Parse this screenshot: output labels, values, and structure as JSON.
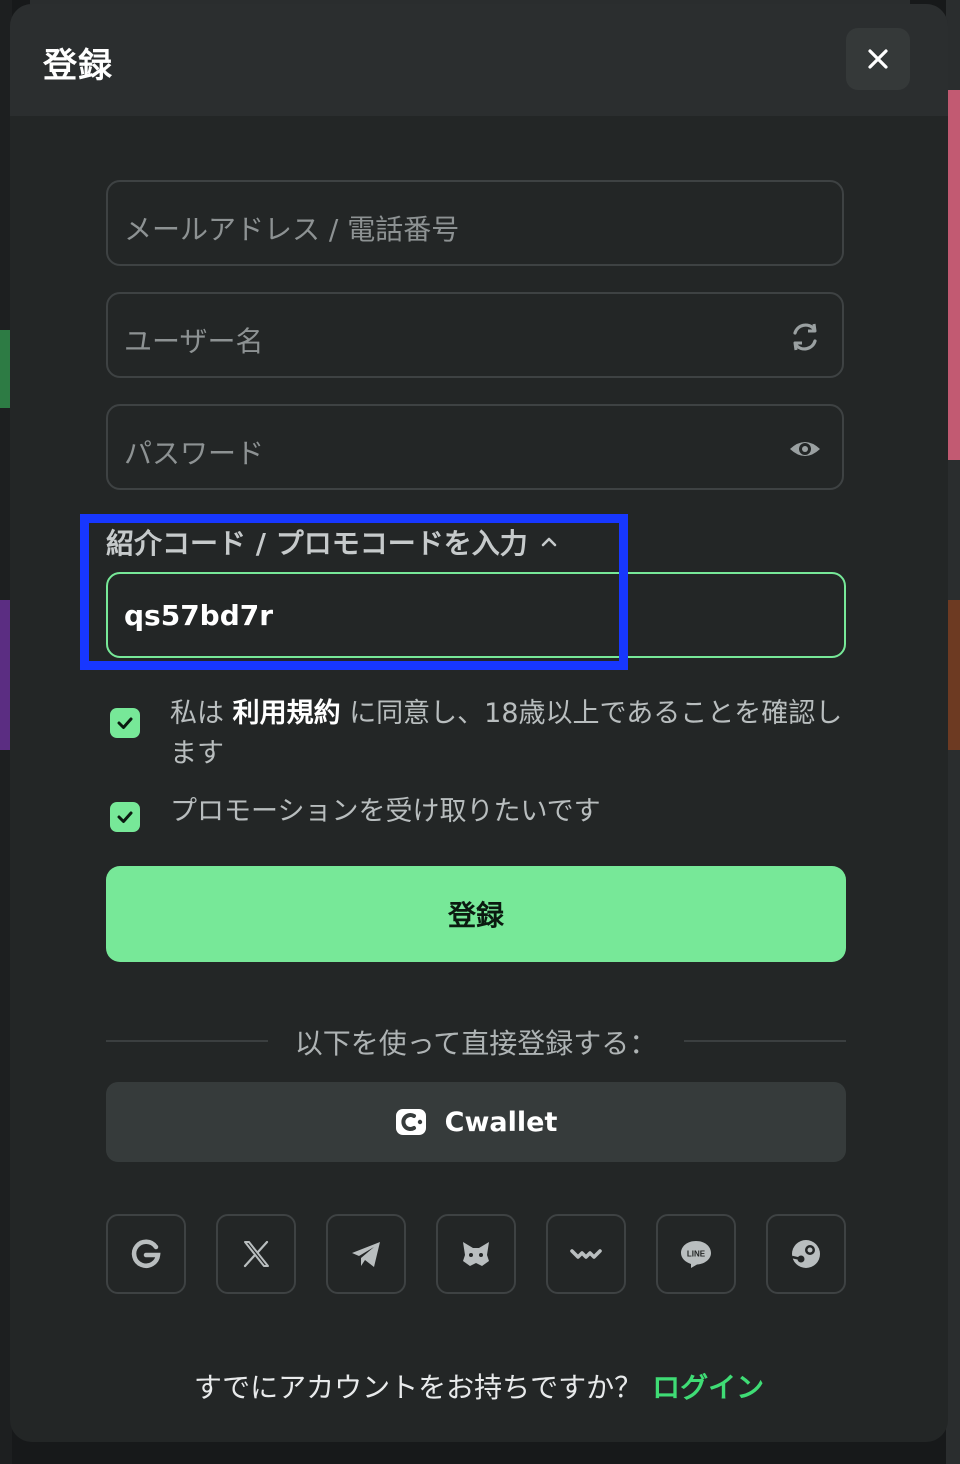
{
  "modal": {
    "title": "登録",
    "close_icon": "close-icon"
  },
  "form": {
    "email_placeholder": "メールアドレス / 電話番号",
    "username_placeholder": "ユーザー名",
    "username_icon": "refresh-icon",
    "password_placeholder": "パスワード",
    "password_icon": "eye-icon",
    "promo_label": "紹介コード / プロモコードを入力",
    "promo_toggle_icon": "chevron-up-icon",
    "promo_value": "qs57bd7r"
  },
  "checks": {
    "terms_prefix": "私は",
    "terms_link": "利用規約",
    "terms_suffix": "に同意し、18歳以上であることを確認します",
    "terms_checked": true,
    "promo_opt_in": "プロモーションを受け取りたいです",
    "promo_checked": true
  },
  "register_button": "登録",
  "divider_text": "以下を使って直接登録する：",
  "cwallet_label": "Cwallet",
  "social_icons": [
    "google-icon",
    "x-icon",
    "telegram-icon",
    "metamask-icon",
    "walletconnect-icon",
    "line-icon",
    "steam-icon"
  ],
  "line_icon_text": "LINE",
  "footer": {
    "question": "すでにアカウントをお持ちですか？",
    "login_link": "ログイン"
  },
  "colors": {
    "accent": "#77e898",
    "login_link": "#3fdc75",
    "highlight": "#1737ff",
    "modal_bg": "#232626"
  }
}
